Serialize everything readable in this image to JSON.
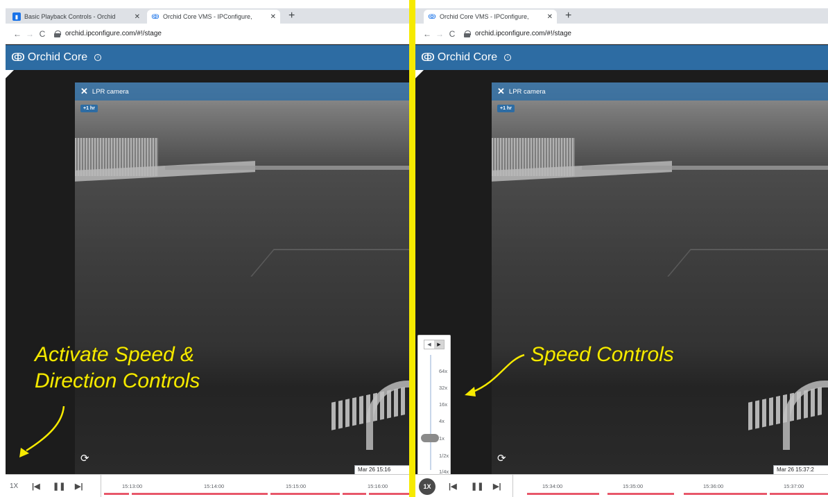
{
  "left": {
    "tabs": [
      {
        "label": "Basic Playback Controls - Orchid",
        "icon": "book-icon",
        "active": false
      },
      {
        "label": "Orchid Core VMS - IPConfigure,",
        "icon": "orchid-icon",
        "active": true
      }
    ],
    "url": "orchid.ipconfigure.com/#!/stage",
    "app_title": "Orchid Core",
    "camera_name": "LPR camera",
    "tz_badge": "+1 hr",
    "timestamp": "Mar 26 15:16",
    "speed_label": "1X",
    "timeline_labels": [
      "15:13:00",
      "15:14:00",
      "15:15:00",
      "15:16:00"
    ]
  },
  "right": {
    "tabs": [
      {
        "label": "Orchid Core VMS - IPConfigure,",
        "icon": "orchid-icon",
        "active": true
      }
    ],
    "url": "orchid.ipconfigure.com/#!/stage",
    "app_title": "Orchid Core",
    "camera_name": "LPR camera",
    "tz_badge": "+1 hr",
    "timestamp": "Mar 26 15:37:2",
    "speed_label": "1X",
    "timeline_labels": [
      "15:34:00",
      "15:35:00",
      "15:36:00",
      "15:37:00"
    ],
    "speed_options": [
      "64x",
      "32x",
      "16x",
      "4x",
      "1x",
      "1/2x",
      "1/4x"
    ],
    "selected_speed": "1x"
  },
  "annotations": {
    "left": [
      "Activate Speed &",
      "Direction Controls"
    ],
    "right": "Speed Controls"
  },
  "colors": {
    "header": "#2d6ca3",
    "highlight": "#f6ea00",
    "recording": "#e8576a"
  }
}
